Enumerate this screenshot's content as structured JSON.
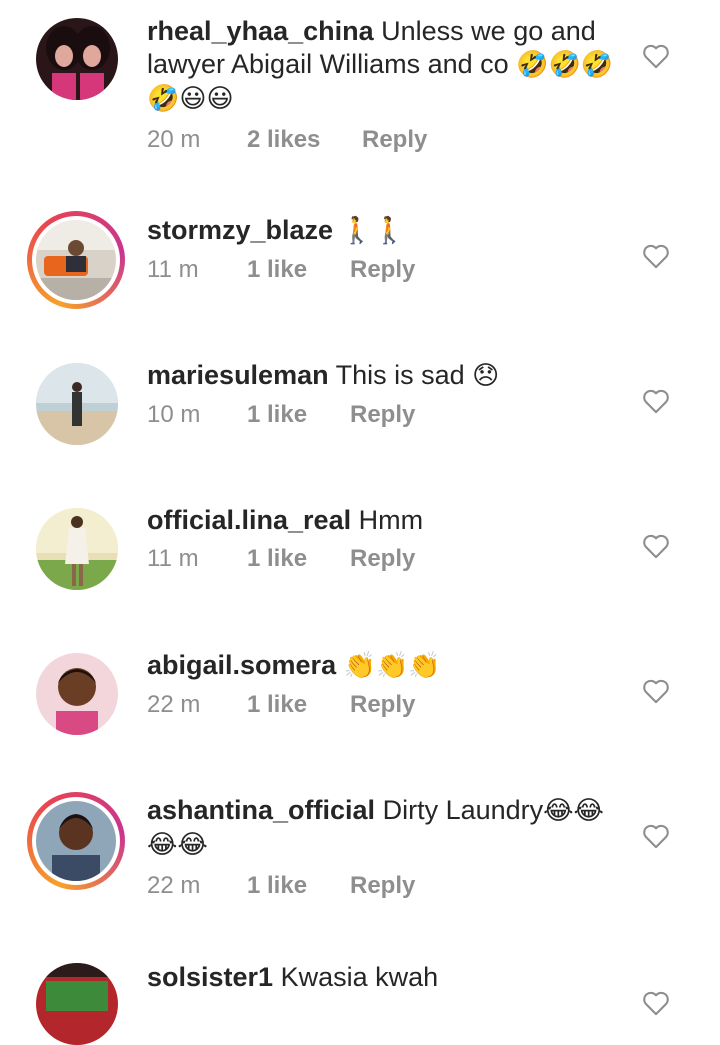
{
  "comments": [
    {
      "username": "rheal_yhaa_china",
      "text": "Unless we go and lawyer Abigail Williams and co",
      "emoji_line": "🤣🤣🤣🤣😃😃",
      "time": "20 m",
      "likes": "2 likes",
      "reply": "Reply"
    },
    {
      "username": "stormzy_blaze",
      "text": "",
      "emoji_line": "🚶🚶",
      "time": "11 m",
      "likes": "1 like",
      "reply": "Reply"
    },
    {
      "username": "mariesuleman",
      "text": "This is sad",
      "emoji_line": "😞",
      "time": "10 m",
      "likes": "1 like",
      "reply": "Reply"
    },
    {
      "username": "official.lina_real",
      "text": "Hmm",
      "emoji_line": "",
      "time": "11 m",
      "likes": "1 like",
      "reply": "Reply"
    },
    {
      "username": "abigail.somera",
      "text": "",
      "emoji_line": "👏👏👏",
      "time": "22 m",
      "likes": "1 like",
      "reply": "Reply"
    },
    {
      "username": "ashantina_official",
      "text": "Dirty Laundry",
      "emoji_line": "😂😂😂😂",
      "time": "22 m",
      "likes": "1 like",
      "reply": "Reply"
    },
    {
      "username": "solsister1",
      "text": "Kwasia kwah",
      "emoji_line": "",
      "time": "",
      "likes": "",
      "reply": ""
    }
  ],
  "icons": {
    "like": "heart-outline-icon"
  },
  "colors": {
    "text": "#262626",
    "meta": "#8e8e8e",
    "story_ring_start": "#f7a12a",
    "story_ring_end": "#c9358f"
  }
}
